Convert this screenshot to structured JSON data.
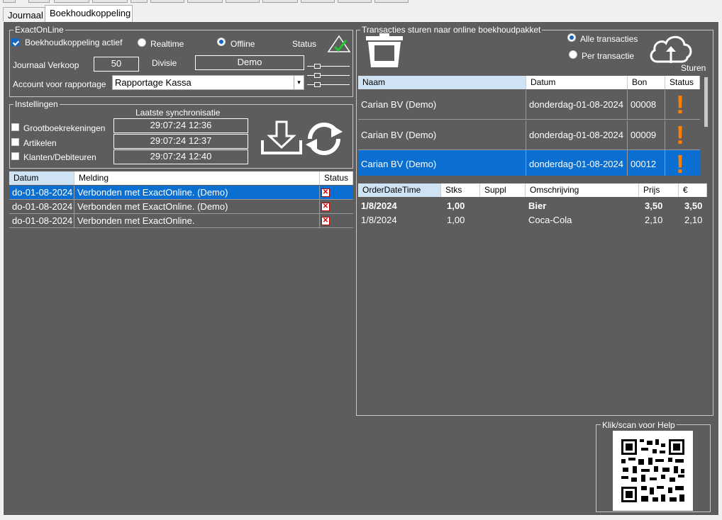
{
  "tabs": [
    {
      "label": "Journaal"
    },
    {
      "label": "Boekhoudkoppeling"
    }
  ],
  "exact": {
    "group_title": "ExactOnLine",
    "actief_label": "Boekhoudkoppeling actief",
    "actief_checked": true,
    "realtime_label": "Realtime",
    "offline_label": "Offline",
    "selected_mode": "Offline",
    "status_label": "Status",
    "status_icon": "checkmark-triangle-icon",
    "journaal_label": "Journaal Verkoop",
    "journaal_value": "50",
    "divisie_label": "Divisie",
    "divisie_value": "Demo",
    "account_label": "Account voor rapportage",
    "account_value": "Rapportage Kassa"
  },
  "settings": {
    "group_title": "Instellingen",
    "sync_header": "Laatste synchronisatie",
    "items": [
      {
        "label": "Grootboekrekeningen",
        "checked": false,
        "time": "29:07:24 12:36"
      },
      {
        "label": "Artikelen",
        "checked": false,
        "time": "29:07:24 12:37"
      },
      {
        "label": "Klanten/Debiteuren",
        "checked": false,
        "time": "29:07:24 12:40"
      }
    ],
    "icons": [
      "download-icon",
      "sync-icon"
    ]
  },
  "log": {
    "columns": [
      "Datum",
      "Melding",
      "Status"
    ],
    "rows": [
      {
        "datum": "do-01-08-2024",
        "melding": "Verbonden met ExactOnline. (Demo)",
        "status_icon": "error-x-icon",
        "selected": true
      },
      {
        "datum": "do-01-08-2024",
        "melding": "Verbonden met ExactOnline. (Demo)",
        "status_icon": "error-x-icon",
        "selected": false
      },
      {
        "datum": "do-01-08-2024",
        "melding": "Verbonden met ExactOnline.",
        "status_icon": "error-x-icon",
        "selected": false
      }
    ]
  },
  "transacties": {
    "group_title": "Transacties sturen  naar online boekhoudpakket",
    "trash_icon": "trash-bin-icon",
    "alle_label": "Alle transacties",
    "per_label": "Per transactie",
    "selected_scope": "Alle transacties",
    "send_icon": "cloud-upload-icon",
    "send_label": "Sturen",
    "columns": [
      "Naam",
      "Datum",
      "Bon",
      "Status"
    ],
    "rows": [
      {
        "naam": "Carian BV (Demo)",
        "datum": "donderdag-01-08-2024",
        "bon": "00008",
        "status": "!",
        "selected": false
      },
      {
        "naam": "Carian BV (Demo)",
        "datum": "donderdag-01-08-2024",
        "bon": "00009",
        "status": "!",
        "selected": false
      },
      {
        "naam": "Carian BV (Demo)",
        "datum": "donderdag-01-08-2024",
        "bon": "00012",
        "status": "!",
        "selected": true
      }
    ],
    "status_color": "#ff8000"
  },
  "orderlines": {
    "columns": [
      "OrderDateTime",
      "Stks",
      "Suppl",
      "Omschrijving",
      "Prijs",
      "€"
    ],
    "rows": [
      {
        "date": "1/8/2024",
        "stks": "1,00",
        "suppl": "",
        "omschrijving": "Bier",
        "prijs": "3,50",
        "total": "3,50",
        "bold": true
      },
      {
        "date": "1/8/2024",
        "stks": "1,00",
        "suppl": "",
        "omschrijving": "Coca-Cola",
        "prijs": "2,10",
        "total": "2,10",
        "bold": false
      }
    ]
  },
  "help": {
    "title": "Klik/scan voor Help",
    "icon": "qr-code-icon"
  },
  "colors": {
    "panel": "#5d5d5d",
    "selection": "#0a6fd0",
    "header_selected": "#cfe3f5"
  }
}
